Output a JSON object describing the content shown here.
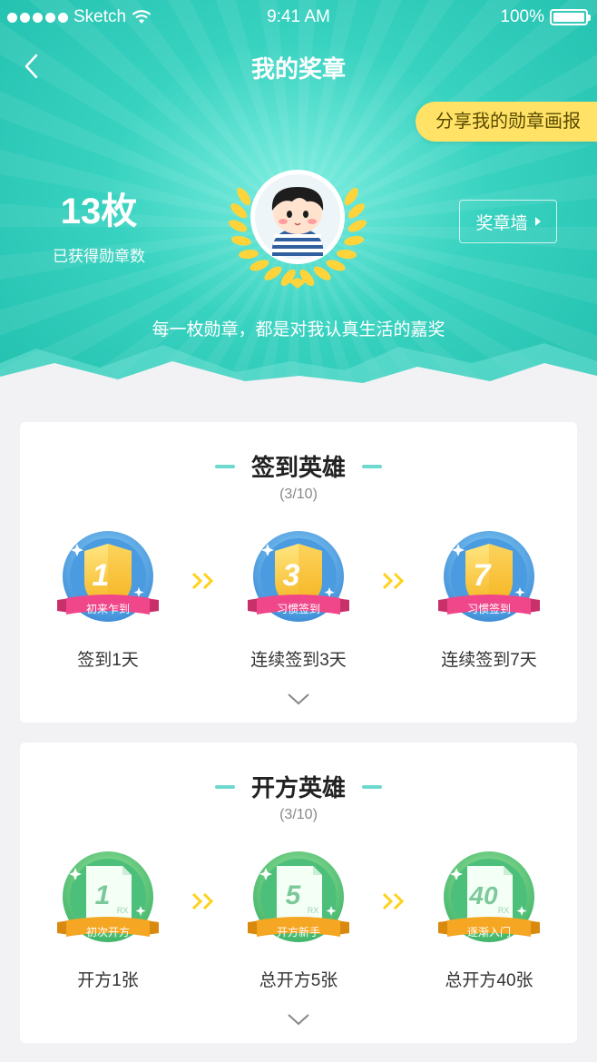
{
  "status_bar": {
    "carrier": "Sketch",
    "time": "9:41 AM",
    "battery": "100%"
  },
  "nav": {
    "title": "我的奖章"
  },
  "share_button": "分享我的勋章画报",
  "medal_count": {
    "value": "13枚",
    "label": "已获得勋章数"
  },
  "wall_button": "奖章墙",
  "motto": "每一枚勋章，都是对我认真生活的嘉奖",
  "colors": {
    "teal": "#2cc8b6",
    "yellow": "#ffe266",
    "pink_ribbon": "#f0468a",
    "orange_ribbon": "#f5a623",
    "gold": "#ffd43b"
  },
  "sections": [
    {
      "title": "签到英雄",
      "progress": "(3/10)",
      "badges": [
        {
          "number": "1",
          "ribbon": "初来乍到",
          "caption": "签到1天"
        },
        {
          "number": "3",
          "ribbon": "习惯签到",
          "caption": "连续签到3天"
        },
        {
          "number": "7",
          "ribbon": "习惯签到",
          "caption": "连续签到7天"
        }
      ]
    },
    {
      "title": "开方英雄",
      "progress": "(3/10)",
      "badges": [
        {
          "number": "1",
          "rx": "RX",
          "ribbon": "初次开方",
          "caption": "开方1张"
        },
        {
          "number": "5",
          "rx": "RX",
          "ribbon": "开方新手",
          "caption": "总开方5张"
        },
        {
          "number": "40",
          "rx": "RX",
          "ribbon": "逐渐入门",
          "caption": "总开方40张"
        }
      ]
    }
  ]
}
